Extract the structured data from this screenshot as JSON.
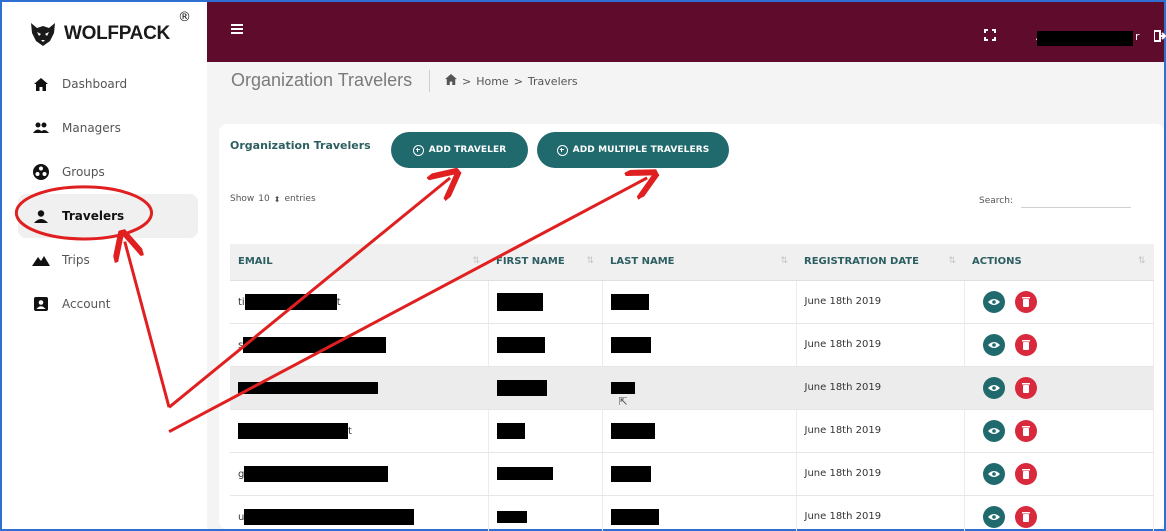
{
  "brand": {
    "name": "WOLFPACK",
    "registered": "®"
  },
  "sidebar": {
    "items": [
      {
        "label": "Dashboard",
        "icon": "home-icon"
      },
      {
        "label": "Managers",
        "icon": "users-icon"
      },
      {
        "label": "Groups",
        "icon": "groups-icon"
      },
      {
        "label": "Travelers",
        "icon": "user-icon",
        "active": true
      },
      {
        "label": "Trips",
        "icon": "mountain-icon"
      },
      {
        "label": "Account",
        "icon": "account-card-icon"
      }
    ]
  },
  "topbar": {
    "user_name_prefix": ".",
    "user_name_suffix": "r"
  },
  "page": {
    "title": "Organization Travelers",
    "breadcrumb": [
      "Home",
      "Travelers"
    ],
    "breadcrumb_sep": ">"
  },
  "card": {
    "title": "Organization Travelers",
    "add_traveler_label": "ADD TRAVELER",
    "add_multiple_label": "ADD MULTIPLE TRAVELERS",
    "show_label": "Show",
    "entries_value": "10",
    "entries_label": "entries",
    "search_label": "Search:",
    "search_placeholder": ""
  },
  "table": {
    "columns": [
      "EMAIL",
      "FIRST NAME",
      "LAST NAME",
      "REGISTRATION DATE",
      "ACTIONS"
    ],
    "rows": [
      {
        "email_prefix": "ti",
        "email_suffix": "t",
        "date": "June 18th 2019"
      },
      {
        "email_prefix": "s",
        "email_suffix": "",
        "date": "June 18th 2019"
      },
      {
        "email_prefix": "",
        "email_suffix": "",
        "date": "June 18th 2019"
      },
      {
        "email_prefix": "",
        "email_suffix": "t",
        "date": "June 18th 2019"
      },
      {
        "email_prefix": "g",
        "email_suffix": "",
        "date": "June 18th 2019"
      },
      {
        "email_prefix": "u",
        "email_suffix": "",
        "date": "June 18th 2019"
      }
    ]
  },
  "annotations": {
    "color": "#e02020",
    "arrows": [
      {
        "from": [
          0.145,
          0.767
        ],
        "to": [
          0.107,
          0.455
        ]
      },
      {
        "from": [
          0.145,
          0.767
        ],
        "to": [
          0.386,
          0.335
        ]
      },
      {
        "from": [
          0.145,
          0.813
        ],
        "to": [
          0.555,
          0.335
        ]
      }
    ],
    "circle": {
      "center": [
        0.072,
        0.401
      ],
      "radius_x": 0.058,
      "radius_y": 0.049
    }
  },
  "colors": {
    "topbar": "#5e0b2c",
    "primary": "#206a6e",
    "danger": "#d9293c",
    "annotation": "#e02020"
  }
}
